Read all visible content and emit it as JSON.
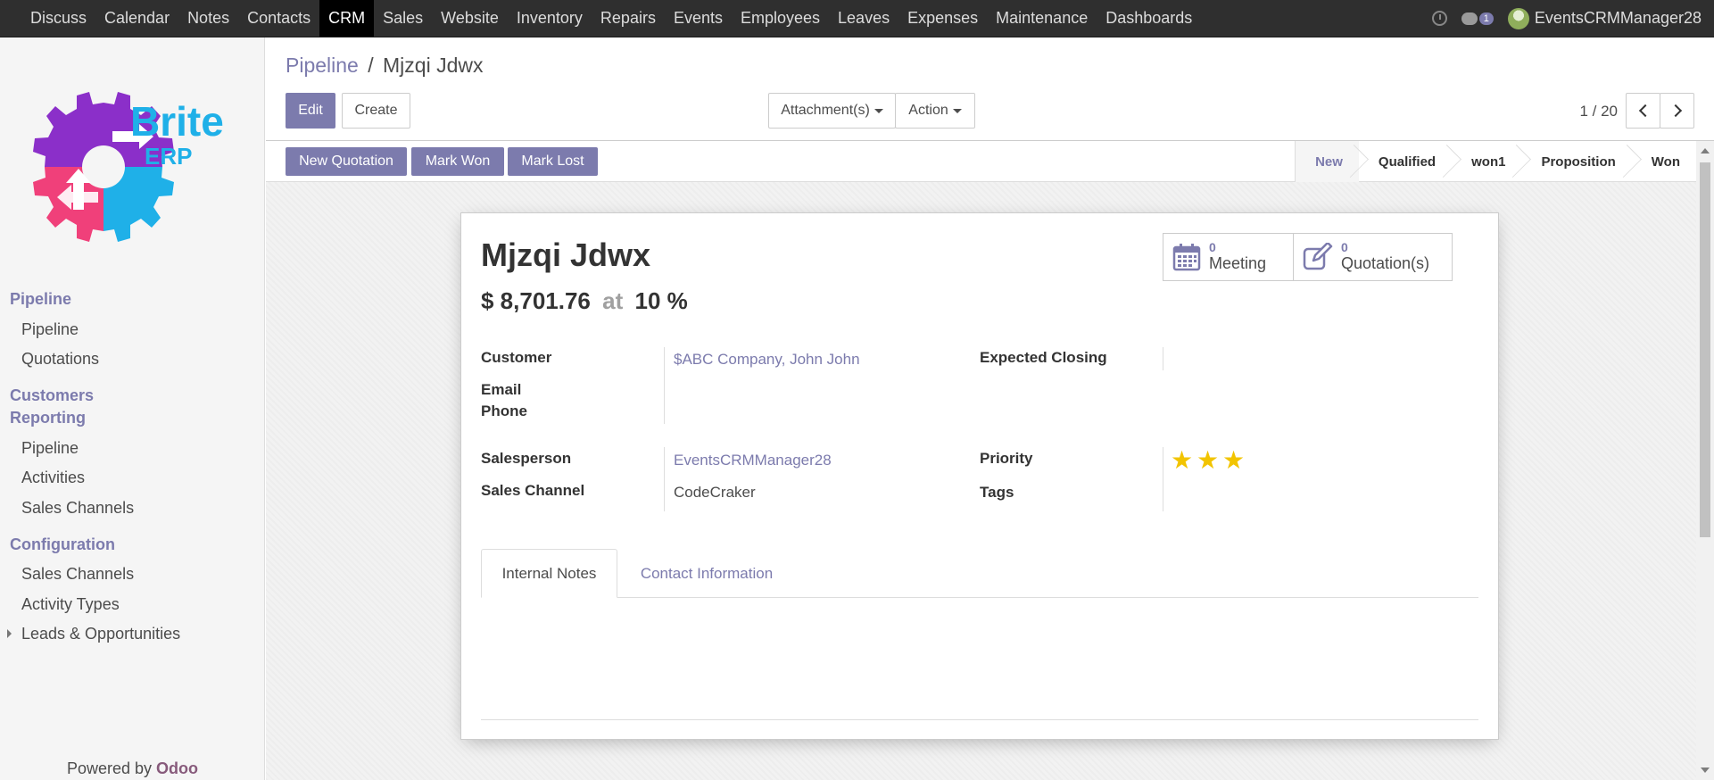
{
  "nav": {
    "menu": [
      "Discuss",
      "Calendar",
      "Notes",
      "Contacts",
      "CRM",
      "Sales",
      "Website",
      "Inventory",
      "Repairs",
      "Events",
      "Employees",
      "Leaves",
      "Expenses",
      "Maintenance",
      "Dashboards"
    ],
    "active": "CRM",
    "message_count": "1",
    "user": "EventsCRMManager28"
  },
  "sidebar": {
    "logo_text": "Brite",
    "logo_sub": "ERP",
    "sections": [
      {
        "title": "Pipeline",
        "items": [
          "Pipeline",
          "Quotations"
        ]
      },
      {
        "title": "Customers",
        "items": []
      },
      {
        "title": "Reporting",
        "items": [
          "Pipeline",
          "Activities",
          "Sales Channels"
        ]
      },
      {
        "title": "Configuration",
        "items": [
          "Sales Channels",
          "Activity Types",
          "Leads & Opportunities"
        ]
      }
    ],
    "powered_by": "Powered by",
    "powered_brand": "Odoo"
  },
  "breadcrumb": {
    "parent": "Pipeline",
    "sep": "/",
    "current": "Mjzqi Jdwx"
  },
  "toolbar": {
    "edit": "Edit",
    "create": "Create",
    "attachments": "Attachment(s)",
    "action": "Action"
  },
  "pager": {
    "value": "1 / 20"
  },
  "statusbar": {
    "buttons": [
      "New Quotation",
      "Mark Won",
      "Mark Lost"
    ],
    "stages": [
      "New",
      "Qualified",
      "won1",
      "Proposition",
      "Won"
    ],
    "current_stage": "New"
  },
  "record": {
    "name": "Mjzqi Jdwx",
    "revenue": "$ 8,701.76",
    "at": "at",
    "probability": "10 %",
    "smart_buttons": [
      {
        "count": "0",
        "label": "Meeting",
        "icon": "calendar-icon"
      },
      {
        "count": "0",
        "label": "Quotation(s)",
        "icon": "edit-icon"
      }
    ],
    "fields": {
      "customer_label": "Customer",
      "customer_value": "$ABC Company, John John",
      "email_label": "Email",
      "phone_label": "Phone",
      "salesperson_label": "Salesperson",
      "salesperson_value": "EventsCRMManager28",
      "sales_channel_label": "Sales Channel",
      "sales_channel_value": "CodeCraker",
      "expected_closing_label": "Expected Closing",
      "priority_label": "Priority",
      "priority_stars": 3,
      "tags_label": "Tags"
    },
    "tabs": [
      "Internal Notes",
      "Contact Information"
    ],
    "active_tab": "Internal Notes"
  },
  "colors": {
    "primary": "#7c7bad",
    "navbar": "#2f2f2f",
    "star": "#f2c400",
    "brand_odoo": "#875a7b"
  }
}
